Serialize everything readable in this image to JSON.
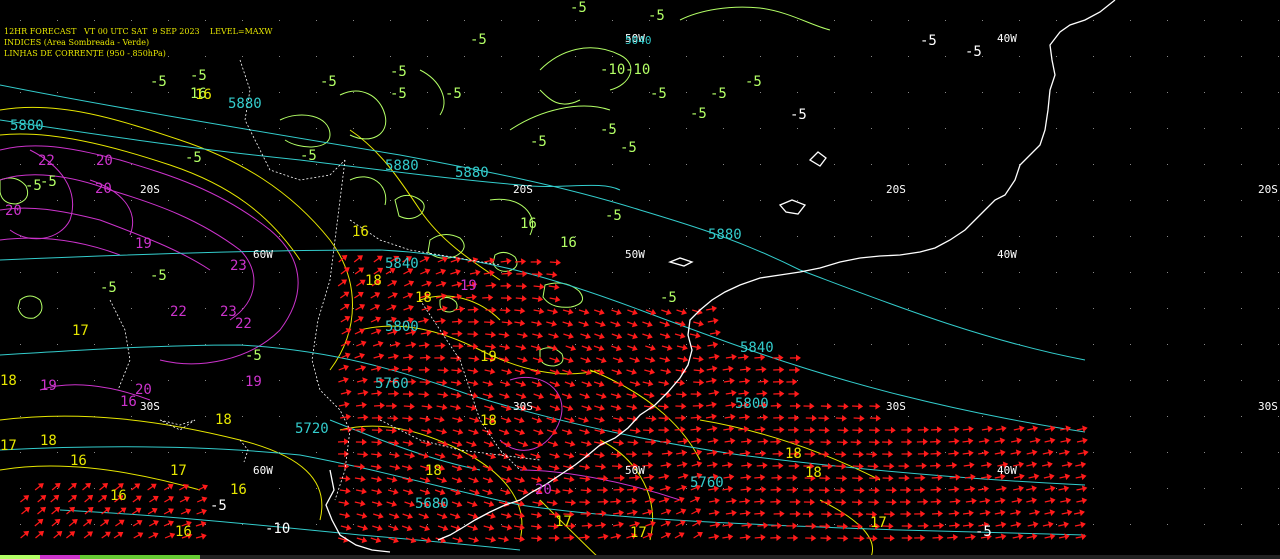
{
  "header": {
    "line1": "12HR FORECAST   VT 00 UTC SAT  9 SEP 2023    LEVEL=MAXW",
    "line2": "INDICES (Area Sombreada - Verde)",
    "line3": "LINHAS DE CORRENTE (950 - 850hPa)"
  },
  "colors": {
    "background": "#000000",
    "header_text": "#e6e600",
    "coast": "#ffffff",
    "geopotential_contours": "#33cccc",
    "index_contours_magenta": "#cc33cc",
    "index_contours_yellow": "#e6e600",
    "index_contours_green": "#b3ff66",
    "wind_arrows": "#ff1a1a",
    "grid_labels": "#ffffff"
  },
  "grid_labels": {
    "lat_20s": "20S",
    "lat_30s": "30S",
    "lon_40w": "40W",
    "lon_50w": "50W",
    "lon_60w": "60W"
  },
  "geopotential_labels": [
    "5880",
    "5880",
    "5880",
    "5880",
    "5880",
    "5840",
    "5840",
    "5800",
    "5800",
    "5760",
    "5760",
    "5720",
    "5680",
    "5040"
  ],
  "index_labels_green": [
    "-5",
    "-5",
    "-5",
    "-5",
    "-5",
    "-5",
    "-5",
    "-5",
    "-5",
    "-5",
    "-5",
    "-5",
    "-5",
    "-5",
    "-5",
    "-5",
    "-5",
    "-5",
    "-5",
    "-5",
    "-5",
    "-5",
    "-5",
    "-5",
    "-5",
    "-10",
    "-10",
    "16",
    "16",
    "16"
  ],
  "index_labels_magenta": [
    "22",
    "20",
    "20",
    "20",
    "19",
    "23",
    "22",
    "23",
    "22",
    "19",
    "19",
    "20",
    "16",
    "19",
    "20"
  ],
  "index_labels_yellow": [
    "16",
    "16",
    "18",
    "18",
    "17",
    "18",
    "18",
    "17",
    "18",
    "17",
    "16",
    "18",
    "18",
    "16",
    "17",
    "17",
    "16",
    "18",
    "18",
    "17",
    "19",
    "16"
  ],
  "index_labels_white": [
    "-5",
    "-5",
    "-5",
    "-10",
    "-5",
    "-5"
  ]
}
